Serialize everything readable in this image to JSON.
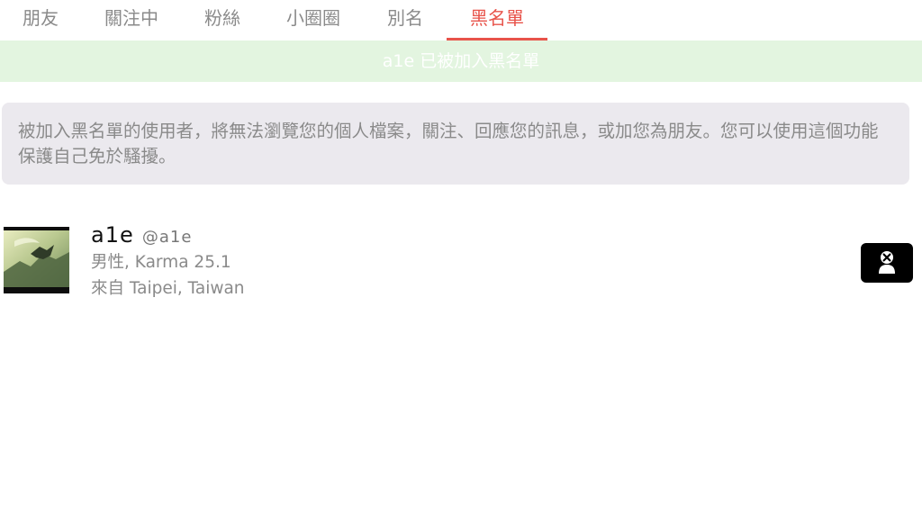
{
  "tabs": [
    {
      "label": "朋友",
      "active": false
    },
    {
      "label": "關注中",
      "active": false
    },
    {
      "label": "粉絲",
      "active": false
    },
    {
      "label": "小圈圈",
      "active": false
    },
    {
      "label": "別名",
      "active": false
    },
    {
      "label": "黑名單",
      "active": true
    }
  ],
  "notice": {
    "text": "a1e 已被加入黑名單"
  },
  "info": {
    "text": "被加入黑名單的使用者，將無法瀏覽您的個人檔案，關注、回應您的訊息，或加您為朋友。您可以使用這個功能保護自己免於騷擾。"
  },
  "blocked_users": [
    {
      "username": "a1e",
      "handle": "@a1e",
      "gender_karma": "男性, Karma 25.1",
      "location": "來自 Taipei, Taiwan"
    }
  ],
  "colors": {
    "accent": "#e8534a",
    "notice_bg": "#e3f5e0",
    "info_bg": "#ebe9ee",
    "muted_text": "#8a8a8a"
  },
  "icons": {
    "unblock": "user-x-icon"
  }
}
